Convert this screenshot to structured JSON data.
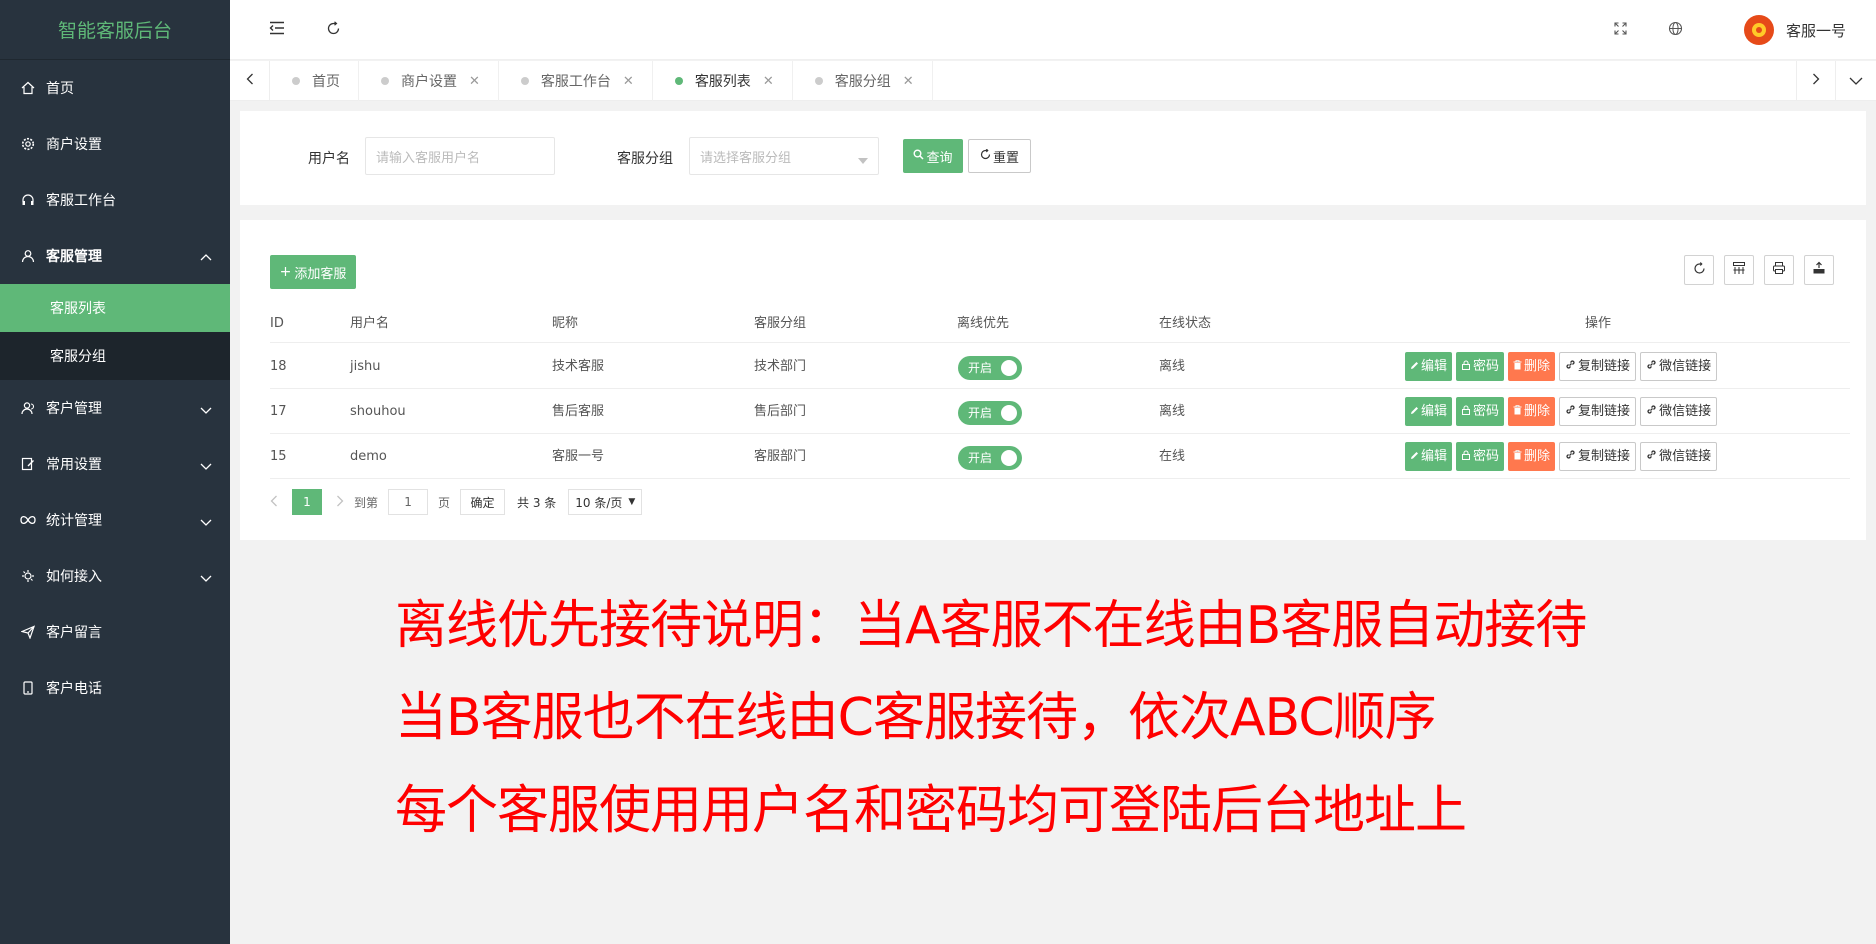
{
  "app": {
    "title": "智能客服后台"
  },
  "sidebar": {
    "items": [
      {
        "label": "首页",
        "icon": "home-icon"
      },
      {
        "label": "商户设置",
        "icon": "gear-icon"
      },
      {
        "label": "客服工作台",
        "icon": "headset-icon"
      },
      {
        "label": "客服管理",
        "icon": "user-icon",
        "expanded": true
      },
      {
        "label": "客户管理",
        "icon": "users-icon"
      },
      {
        "label": "常用设置",
        "icon": "edit-icon"
      },
      {
        "label": "统计管理",
        "icon": "infinity-icon"
      },
      {
        "label": "如何接入",
        "icon": "plug-icon"
      },
      {
        "label": "客户留言",
        "icon": "send-icon"
      },
      {
        "label": "客户电话",
        "icon": "phone-icon"
      }
    ],
    "submenu": [
      {
        "label": "客服列表",
        "active": true
      },
      {
        "label": "客服分组",
        "active": false
      }
    ]
  },
  "header": {
    "user_name": "客服一号"
  },
  "tabs": [
    {
      "label": "首页",
      "closable": false
    },
    {
      "label": "商户设置",
      "closable": true
    },
    {
      "label": "客服工作台",
      "closable": true
    },
    {
      "label": "客服列表",
      "closable": true,
      "active": true
    },
    {
      "label": "客服分组",
      "closable": true
    }
  ],
  "search": {
    "username_label": "用户名",
    "username_placeholder": "请输入客服用户名",
    "group_label": "客服分组",
    "group_placeholder": "请选择客服分组",
    "query_button": "查询",
    "reset_button": "重置"
  },
  "table": {
    "add_button": "添加客服",
    "columns": [
      "ID",
      "用户名",
      "昵称",
      "客服分组",
      "离线优先",
      "在线状态",
      "操作"
    ],
    "rows": [
      {
        "id": "18",
        "username": "jishu",
        "nickname": "技术客服",
        "group": "技术部门",
        "offline_priority": "开启",
        "status": "离线"
      },
      {
        "id": "17",
        "username": "shouhou",
        "nickname": "售后客服",
        "group": "售后部门",
        "offline_priority": "开启",
        "status": "离线"
      },
      {
        "id": "15",
        "username": "demo",
        "nickname": "客服一号",
        "group": "客服部门",
        "offline_priority": "开启",
        "status": "在线"
      }
    ],
    "actions": {
      "edit": "编辑",
      "password": "密码",
      "delete": "删除",
      "copy_link": "复制链接",
      "wechat_link": "微信链接"
    }
  },
  "pager": {
    "current_page": "1",
    "goto_label": "到第",
    "goto_value": "1",
    "page_label": "页",
    "confirm": "确定",
    "total": "共 3 条",
    "page_size": "10 条/页"
  },
  "annotations": [
    "离线优先接待说明：当A客服不在线由B客服自动接待",
    "当B客服也不在线由C客服接待，依次ABC顺序",
    "每个客服使用用户名和密码均可登陆后台地址上"
  ],
  "colors": {
    "accent": "#5fb878",
    "sidebar_bg": "#28333e",
    "danger": "#ff5722",
    "annotation": "#ff0000"
  }
}
